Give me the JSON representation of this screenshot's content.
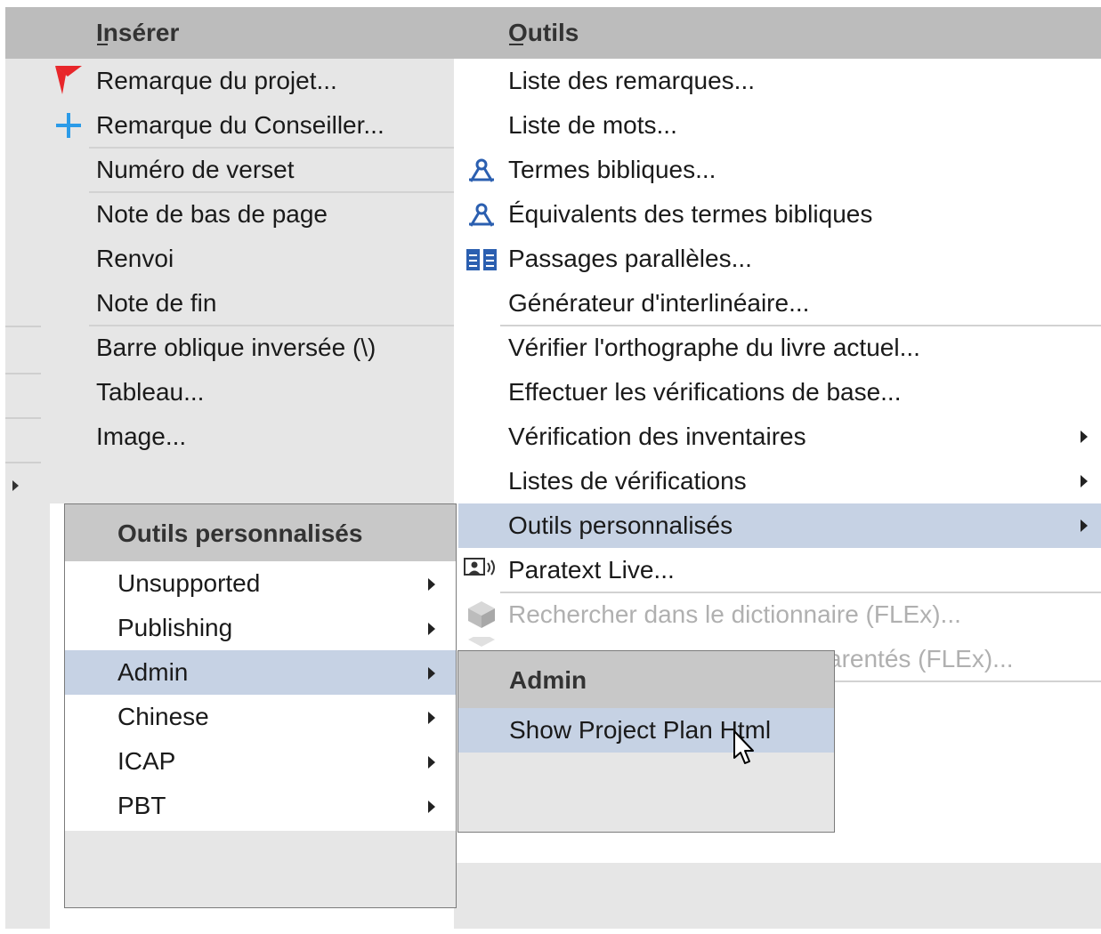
{
  "colors": {
    "menubar_bg": "#bcbcbc",
    "panel_gray": "#e6e6e6",
    "highlight": "#c6d2e4",
    "flag_red": "#e8262a",
    "plus_blue": "#2b9be8",
    "icon_blue": "#2b5fb0",
    "disabled_text": "#b0b0b0"
  },
  "menubar": {
    "insert_label": "Insérer",
    "tools_label": "Outils"
  },
  "insert_menu": {
    "items": [
      {
        "label": "Remarque du projet...",
        "icon": "red-flag-icon"
      },
      {
        "label": "Remarque du Conseiller...",
        "icon": "blue-plus-icon"
      },
      {
        "label": "Numéro de verset"
      },
      {
        "label": "Note de bas de page"
      },
      {
        "label": "Renvoi"
      },
      {
        "label": "Note de fin"
      },
      {
        "label": "Barre oblique inversée (\\)"
      },
      {
        "label": "Tableau..."
      },
      {
        "label": "Image..."
      }
    ]
  },
  "tools_menu": {
    "items": [
      {
        "label": "Liste des remarques..."
      },
      {
        "label": "Liste de mots..."
      },
      {
        "label": "Termes bibliques...",
        "icon": "biblical-terms-icon"
      },
      {
        "label": "Équivalents des termes bibliques",
        "icon": "biblical-terms-icon"
      },
      {
        "label": "Passages parallèles...",
        "icon": "parallel-passages-icon"
      },
      {
        "label": "Générateur d'interlinéaire..."
      },
      {
        "label": "Vérifier l'orthographe du livre actuel..."
      },
      {
        "label": "Effectuer les vérifications de base..."
      },
      {
        "label": "Vérification des inventaires",
        "submenu": true
      },
      {
        "label": "Listes de vérifications",
        "submenu": true
      },
      {
        "label": "Outils personnalisés",
        "submenu": true,
        "highlighted": true
      },
      {
        "label": "Paratext Live...",
        "icon": "paratext-live-icon"
      },
      {
        "label": "Rechercher dans le dictionnaire (FLEx)...",
        "icon": "flex-cube-icon",
        "disabled": true
      },
      {
        "label": "arentés (FLEx)...",
        "disabled": true
      }
    ]
  },
  "custom_tools_menu": {
    "title": "Outils personnalisés",
    "items": [
      {
        "label": "Unsupported",
        "submenu": true
      },
      {
        "label": "Publishing",
        "submenu": true
      },
      {
        "label": "Admin",
        "submenu": true,
        "highlighted": true
      },
      {
        "label": "Chinese",
        "submenu": true
      },
      {
        "label": "ICAP",
        "submenu": true
      },
      {
        "label": "PBT",
        "submenu": true
      }
    ]
  },
  "admin_menu": {
    "title": "Admin",
    "items": [
      {
        "label": "Show Project Plan Html",
        "highlighted": true
      }
    ]
  }
}
